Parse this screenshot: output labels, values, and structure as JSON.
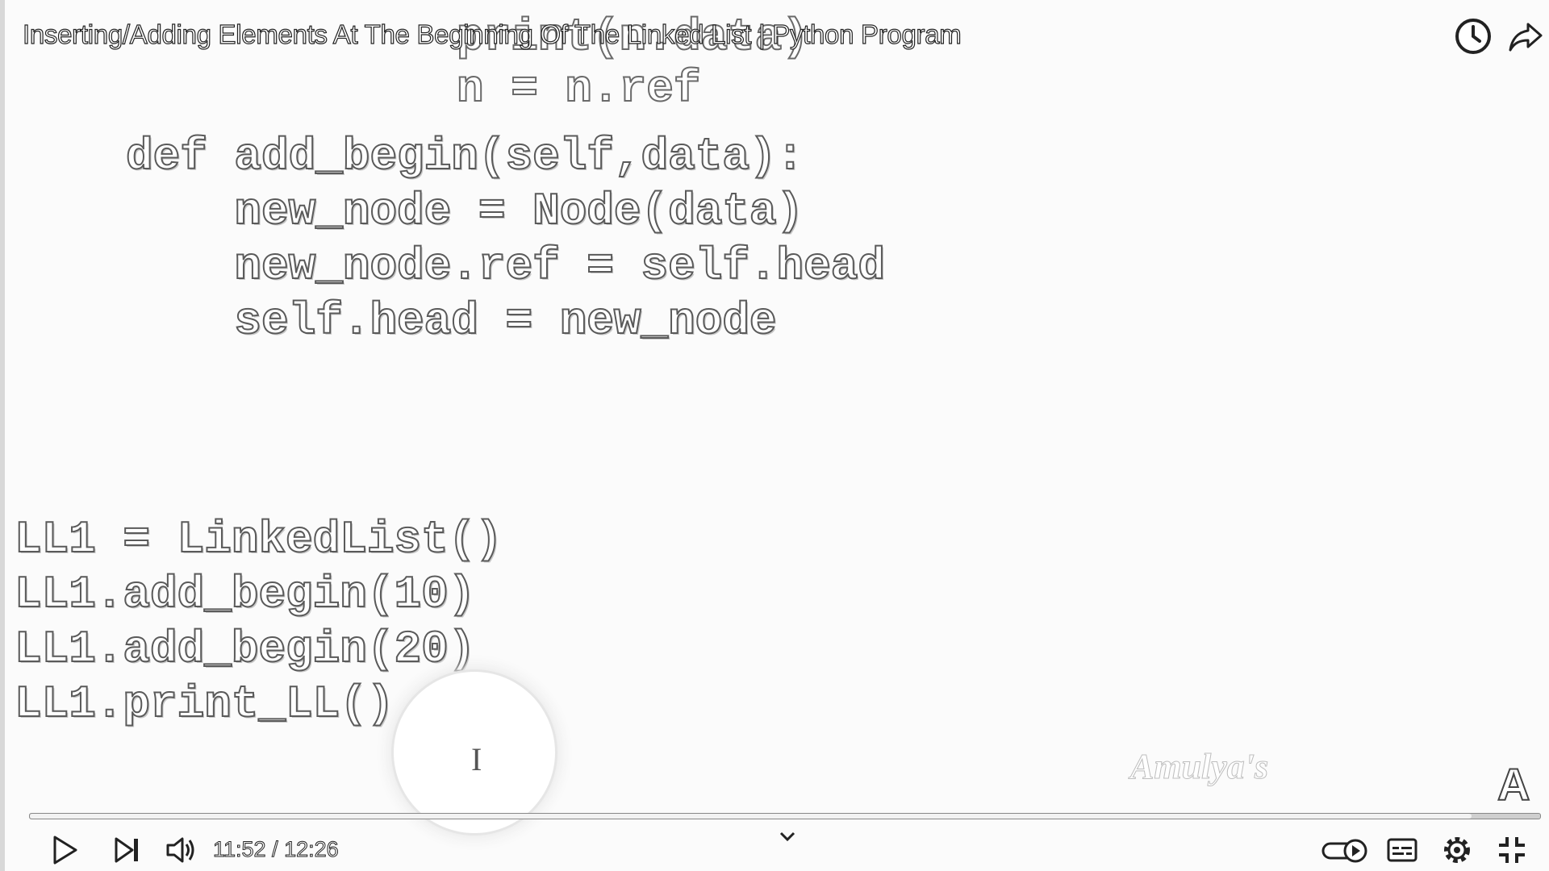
{
  "video": {
    "title": "Inserting/Adding Elements At The Beginning Of The Linked List | Python Program",
    "watermark": "Amulya's",
    "channel_logo_letter": "A"
  },
  "code": {
    "faded_top": [
      "print(n.data)",
      "n = n.ref"
    ],
    "method_lines": [
      "def add_begin(self,data):",
      "    new_node = Node(data)",
      "    new_node.ref = self.head",
      "    self.head = new_node"
    ],
    "usage_lines": [
      "LL1 = LinkedList()",
      "LL1.add_begin(10)",
      "LL1.add_begin(20)",
      "LL1.print_LL()"
    ]
  },
  "player": {
    "time_display": "11:52 / 12:26",
    "progress_fraction": 0.9544,
    "icons": {
      "watch_later": "clock-icon",
      "share": "share-icon",
      "play": "play-icon",
      "next": "next-icon",
      "volume": "volume-icon",
      "chevron": "chevron-down-icon",
      "autoplay": "autoplay-toggle-icon",
      "subtitles": "subtitles-icon",
      "settings": "gear-icon",
      "exit_fullscreen": "exit-fullscreen-icon"
    },
    "colors": {
      "progress_fill": "#f2f2f2",
      "track": "#cfcfcf"
    }
  }
}
